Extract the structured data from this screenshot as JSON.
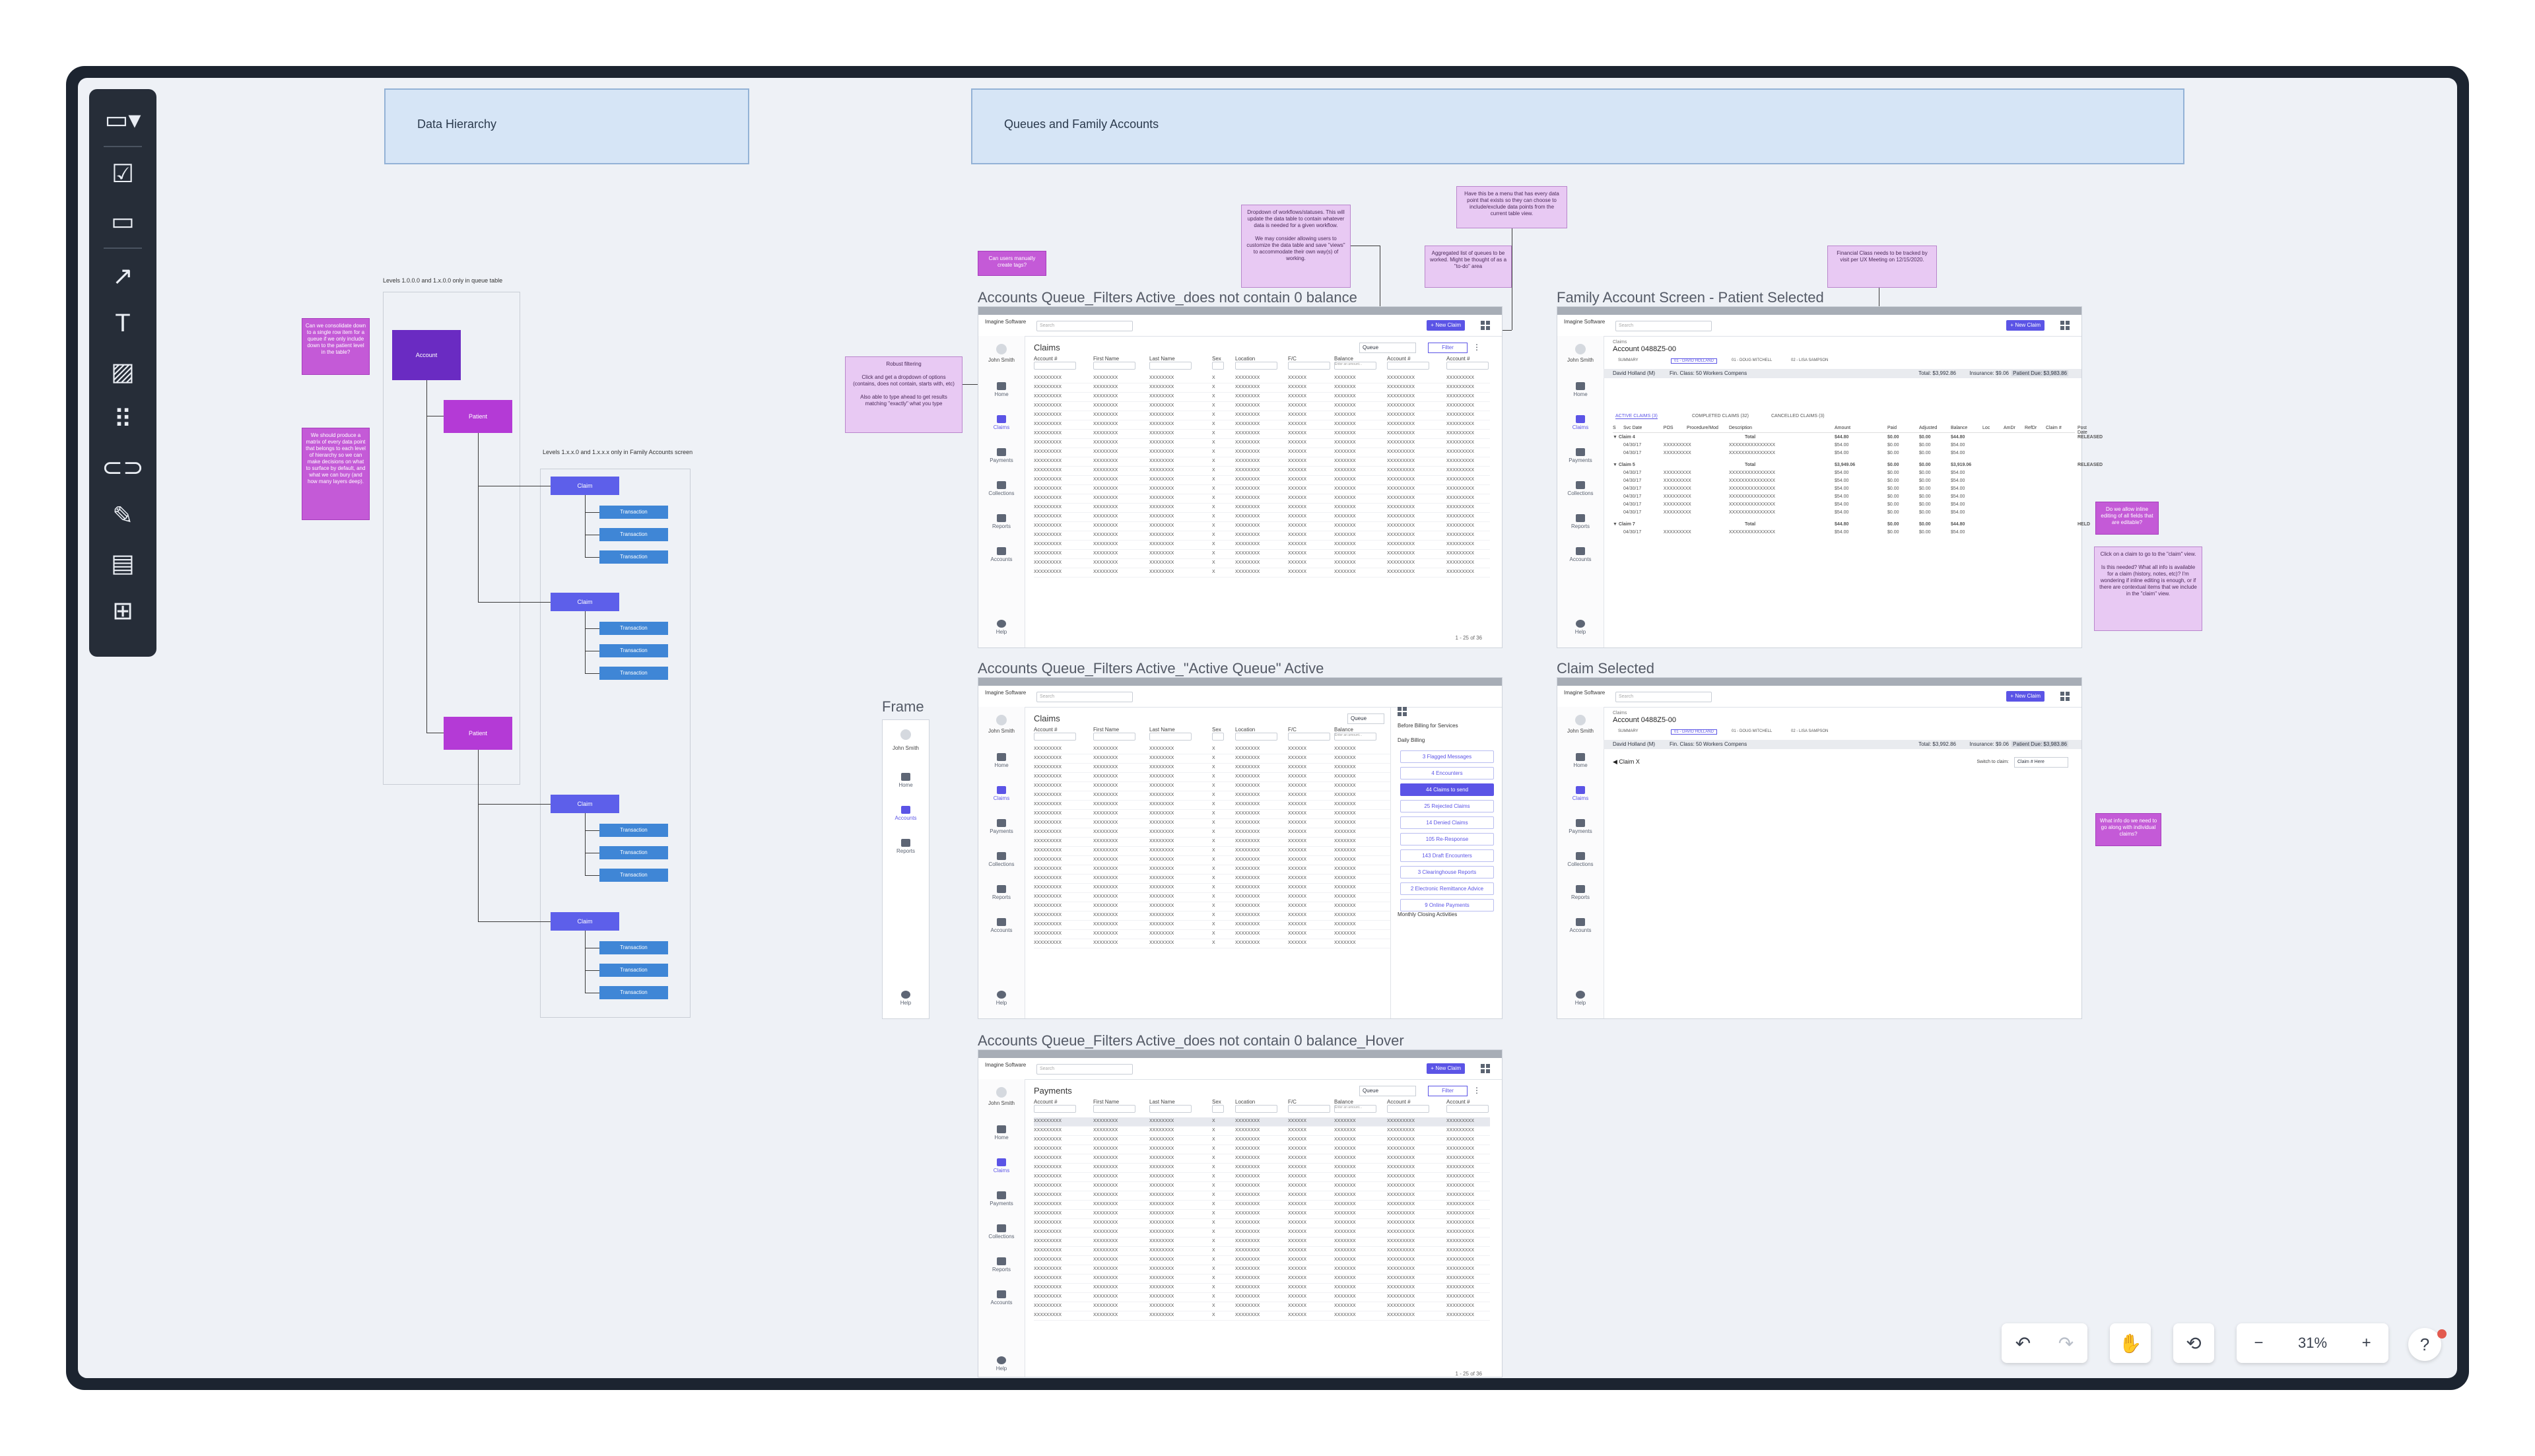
{
  "sections": {
    "data_hierarchy": "Data Hierarchy",
    "queues": "Queues and Family Accounts"
  },
  "hierarchy": {
    "label1": "Levels 1.0.0.0 and 1.x.0.0 only in queue table",
    "label2": "Levels 1.x.x.0 and 1.x.x.x only in Family Accounts screen",
    "account": "Account",
    "patient": "Patient",
    "claim": "Claim",
    "transaction": "Transaction",
    "sticky1": "Can we consolidate down to a single row item for a queue if we only include down to the patient level in the table?",
    "sticky2": "We should produce a matrix of every data point that belongs to each level of hierarchy so we can make decisions on what to surface by default, and what we can bury (and how many layers deep)."
  },
  "frames": {
    "f1_title": "Accounts Queue_Filters Active_does not contain 0 balance",
    "f2_title": "Accounts Queue_Filters Active_\"Active Queue\" Active",
    "f3_title": "Accounts Queue_Filters Active_does not contain 0 balance_Hover",
    "f4_title": "Family Account Screen - Patient Selected",
    "f5_title": "Claim Selected",
    "frame_label": "Frame"
  },
  "app": {
    "logo": "Imagine Software",
    "search_placeholder": "Search",
    "new_claim": "+ New Claim",
    "user": "John Smith",
    "filter": "Filter",
    "queue": "Queue",
    "nav": [
      "Home",
      "Claims",
      "Payments",
      "Collections",
      "Reports",
      "Accounts",
      "Help"
    ],
    "nav_short": [
      "Home",
      "Accounts",
      "Reports",
      "Help"
    ],
    "claims_title": "Claims",
    "payments_title": "Payments",
    "columns": [
      "Account #",
      "First Name",
      "Last Name",
      "Sex",
      "Location",
      "F/C",
      "Balance",
      "Account #",
      "Account #"
    ],
    "balance_placeholder": "Enter an amount...",
    "cells": [
      "XXXXXXXXX",
      "XXXXXXXX",
      "XXXXXXXX",
      "X",
      "XXXXXXXX",
      "XXXXXX",
      "XXXXXXX",
      "XXXXXXXXX",
      "XXXXXXXXX"
    ],
    "pager": "1 - 25 of 36"
  },
  "queue_panel": {
    "before": "Before Billing for Services",
    "daily": "Daily Billing",
    "items": [
      "3 Flagged Messages",
      "4 Encounters",
      "44 Claims to send",
      "25 Rejected Claims",
      "14 Denied Claims",
      "105 Re-Response",
      "143 Draft Encounters",
      "3 Clearinghouse Reports",
      "2 Electronic Remittance Advice",
      "9 Online Payments"
    ],
    "monthly": "Monthly Closing Activities"
  },
  "family": {
    "claims_label": "Claims",
    "account": "Account 0488Z5-00",
    "summary": "SUMMARY",
    "p1": "01 - DAVID HOLLAND",
    "p2": "01 - DOUG MITCHELL",
    "p3": "02 - LISA SAMPSON",
    "patient": "David Holland (M)",
    "fin_class": "Fin. Class: 50 Workers Compens",
    "total": "Total: $3,992.86",
    "insurance": "Insurance: $9.06",
    "patient_due": "Patient Due: $3,983.86",
    "tabs": [
      "ACTIVE CLAIMS (3)",
      "COMPLETED CLAIMS (32)",
      "CANCELLED CLAIMS (3)"
    ],
    "table_headers": [
      "S",
      "Svc Date",
      "POS",
      "Procedure/Mod",
      "Description",
      "Amount",
      "Paid",
      "Adjusted",
      "Balance",
      "Loc",
      "AmDr",
      "RefDr",
      "Claim #",
      "Post Date"
    ],
    "claims": [
      {
        "name": "Claim 4",
        "total": "Total",
        "amount": "$44.80",
        "paid": "$0.00",
        "adj": "$0.00",
        "bal": "$44.80",
        "status": "RELEASED"
      },
      {
        "name": "Claim 5",
        "total": "Total",
        "amount": "$3,949.06",
        "paid": "$0.00",
        "adj": "$0.00",
        "bal": "$3,919.06",
        "status": "RELEASED"
      },
      {
        "name": "Claim 7",
        "total": "Total",
        "amount": "$44.80",
        "paid": "$0.00",
        "adj": "$0.00",
        "bal": "$44.80",
        "status": "HELD"
      }
    ],
    "detail_date": "04/30/17",
    "detail_amount": "$54.00",
    "claim_x": "Claim X",
    "switch": "Switch to claim:",
    "claim_here": "Claim # Here"
  },
  "notes": {
    "n1": "Can users manually create tags?",
    "n2": "Robust filtering\n\nClick and get a dropdown of options (contains, does not contain, starts with, etc)\n\nAlso able to type ahead to get results matching \"exactly\" what you type",
    "n3": "Dropdown of workflows/statuses. This will update the data table to contain whatever data is needed for a given workflow.\n\nWe may consider allowing users to customize the data table and save \"views\" to accommodate their own way(s) of working.",
    "n4": "Aggregated list of queues to be worked. Might be thought of as a \"to-do\" area",
    "n5": "Have this be a menu that has every data point that exists so they can choose to include/exclude data points from the current table view.",
    "n6": "Financial Class needs to be tracked by visit per UX Meeting on 12/15/2020.",
    "n7": "Do we allow inline editing of all fields that are editable?",
    "n8": "Click on a claim to go to the \"claim\" view.\n\nIs this needed? What all info is available for a claim (history, notes, etc)? I'm wondering if inline editing is enough, or if there are contextual items that we include in the \"claim\" view.",
    "n9": "What info do we need to go along with individual claims?"
  },
  "controls": {
    "undo": "↶",
    "redo": "↷",
    "hand": "✋",
    "history": "⟲",
    "zoom_out": "−",
    "zoom": "31%",
    "zoom_in": "+",
    "help": "?"
  }
}
